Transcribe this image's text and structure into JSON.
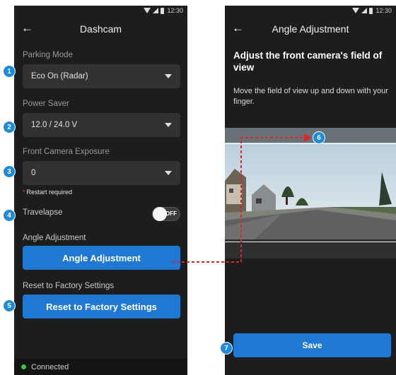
{
  "left_screen": {
    "status_time": "12:30",
    "title": "Dashcam",
    "parking_mode": {
      "label": "Parking Mode",
      "value": "Eco On (Radar)"
    },
    "power_saver": {
      "label": "Power Saver",
      "value": "12.0 / 24.0 V"
    },
    "front_exposure": {
      "label": "Front Camera Exposure",
      "value": "0",
      "note_star": "*",
      "note": "Restart required"
    },
    "travelapse": {
      "label": "Travelapse",
      "toggle_text": "OFF"
    },
    "angle_adjustment": {
      "label": "Angle Adjustment",
      "button": "Angle Adjustment"
    },
    "reset": {
      "label": "Reset to Factory Settings",
      "button": "Reset to Factory Settings"
    },
    "connection_status": "Connected"
  },
  "right_screen": {
    "status_time": "12:30",
    "title": "Angle Adjustment",
    "heading": "Adjust the front camera's field of view",
    "instructions": "Move the field of view up and down with your finger.",
    "save_button": "Save"
  },
  "callouts": [
    "1",
    "2",
    "3",
    "4",
    "5",
    "6",
    "7"
  ],
  "colors": {
    "accent": "#1f78d1",
    "callout": "#1f8ad8",
    "connector": "#d9262a",
    "connected": "#3cc24f",
    "background": "#1d1d1d"
  }
}
